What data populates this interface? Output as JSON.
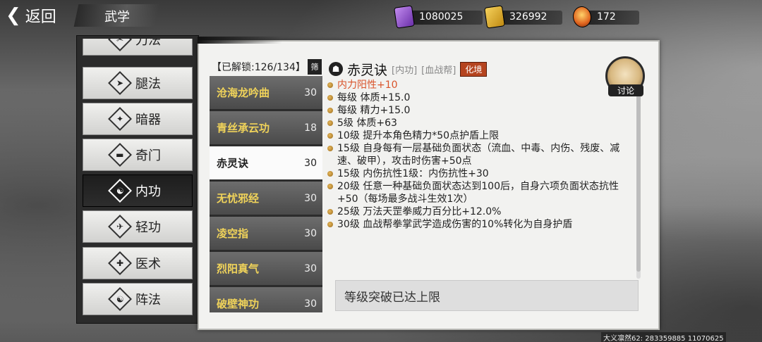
{
  "header": {
    "back_label": "返回",
    "title": "武学"
  },
  "resources": [
    {
      "icon": "purple-scroll-icon",
      "value": "1080025"
    },
    {
      "icon": "gold-scroll-icon",
      "value": "326992"
    },
    {
      "icon": "orange-flame-icon",
      "value": "172"
    }
  ],
  "categories": [
    {
      "label": "刀法",
      "icon": "blade-icon",
      "glyph": "✂"
    },
    {
      "label": "腿法",
      "icon": "kick-icon",
      "glyph": "➤"
    },
    {
      "label": "暗器",
      "icon": "shuriken-icon",
      "glyph": "✦"
    },
    {
      "label": "奇门",
      "icon": "bar-weapon-icon",
      "glyph": "▬"
    },
    {
      "label": "内功",
      "icon": "inner-power-icon",
      "glyph": "☯"
    },
    {
      "label": "轻功",
      "icon": "lightness-icon",
      "glyph": "✈"
    },
    {
      "label": "医术",
      "icon": "medicine-icon",
      "glyph": "✚"
    },
    {
      "label": "阵法",
      "icon": "formation-icon",
      "glyph": "☯"
    }
  ],
  "active_category": "内功",
  "skill_panel": {
    "unlock_text": "【已解锁:126/134】",
    "filter_label": "筛",
    "skills": [
      {
        "name": "沧海龙吟曲",
        "level": "30"
      },
      {
        "name": "青丝承云功",
        "level": "18"
      },
      {
        "name": "赤灵诀",
        "level": "30"
      },
      {
        "name": "无忧邪经",
        "level": "30"
      },
      {
        "name": "凌空指",
        "level": "30"
      },
      {
        "name": "烈阳真气",
        "level": "30"
      },
      {
        "name": "破壁神功",
        "level": "30"
      }
    ],
    "selected_index": 2
  },
  "detail": {
    "name": "赤灵诀",
    "type_tag": "[内功]",
    "sect_tag": "[血战帮]",
    "realm_tag": "化境",
    "attributes": [
      {
        "text": "内力阳性+10",
        "highlight": true
      },
      {
        "text": "每级  体质+15.0",
        "highlight": false
      },
      {
        "text": "每级  精力+15.0",
        "highlight": false
      },
      {
        "text": "5级   体质+63",
        "highlight": false
      },
      {
        "text": "10级  提升本角色精力*50点护盾上限",
        "highlight": false
      },
      {
        "text": "15级  自身每有一层基础负面状态（流血、中毒、内伤、残废、减速、破甲），攻击时伤害+50点",
        "highlight": false
      },
      {
        "text": "15级  内伤抗性1级：内伤抗性+30",
        "highlight": false
      },
      {
        "text": "20级  任意一种基础负面状态达到100后，自身六项负面状态抗性+50（每场最多战斗生效1次）",
        "highlight": false
      },
      {
        "text": "25级  万法天罡拳威力百分比+12.0%",
        "highlight": false
      },
      {
        "text": "30级  血战帮拳掌武学造成伤害的10%转化为自身护盾",
        "highlight": false
      }
    ],
    "breakthrough_text": "等级突破已达上限"
  },
  "discuss": {
    "label": "讨论"
  },
  "footer": {
    "player_info": "大义凛然62: 283359885  11070625"
  }
}
